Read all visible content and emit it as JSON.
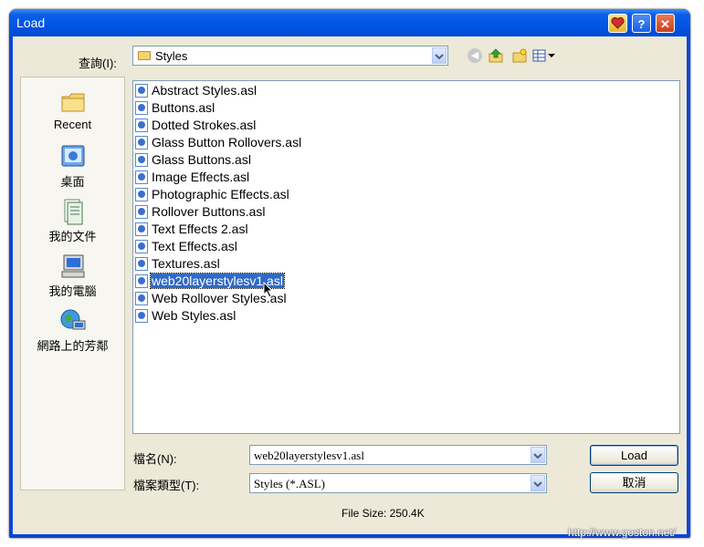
{
  "window": {
    "title": "Load"
  },
  "look_in": {
    "label": "查詢(I):",
    "value": "Styles"
  },
  "places": [
    {
      "label": "Recent",
      "icon": "recent-folder-icon"
    },
    {
      "label": "桌面",
      "icon": "desktop-icon"
    },
    {
      "label": "我的文件",
      "icon": "my-documents-icon"
    },
    {
      "label": "我的電腦",
      "icon": "my-computer-icon"
    },
    {
      "label": "網路上的芳鄰",
      "icon": "network-icon"
    }
  ],
  "files": [
    "Abstract Styles.asl",
    "Buttons.asl",
    "Dotted Strokes.asl",
    "Glass Button Rollovers.asl",
    "Glass Buttons.asl",
    "Image Effects.asl",
    "Photographic Effects.asl",
    "Rollover Buttons.asl",
    "Text Effects 2.asl",
    "Text Effects.asl",
    "Textures.asl",
    "web20layerstylesv1.asl",
    "Web Rollover Styles.asl",
    "Web Styles.asl"
  ],
  "selected_file": "web20layerstylesv1.asl",
  "file_name": {
    "label": "檔名(N):",
    "value": "web20layerstylesv1.asl"
  },
  "file_type": {
    "label": "檔案類型(T):",
    "value": "Styles (*.ASL)"
  },
  "buttons": {
    "load": "Load",
    "cancel": "取消"
  },
  "file_size": "File Size: 250.4K",
  "watermark": "http://www.goston.net/",
  "colors": {
    "selection": "#316ac5",
    "titlebar": "#0055e5",
    "dialog_bg": "#ece9d8"
  }
}
